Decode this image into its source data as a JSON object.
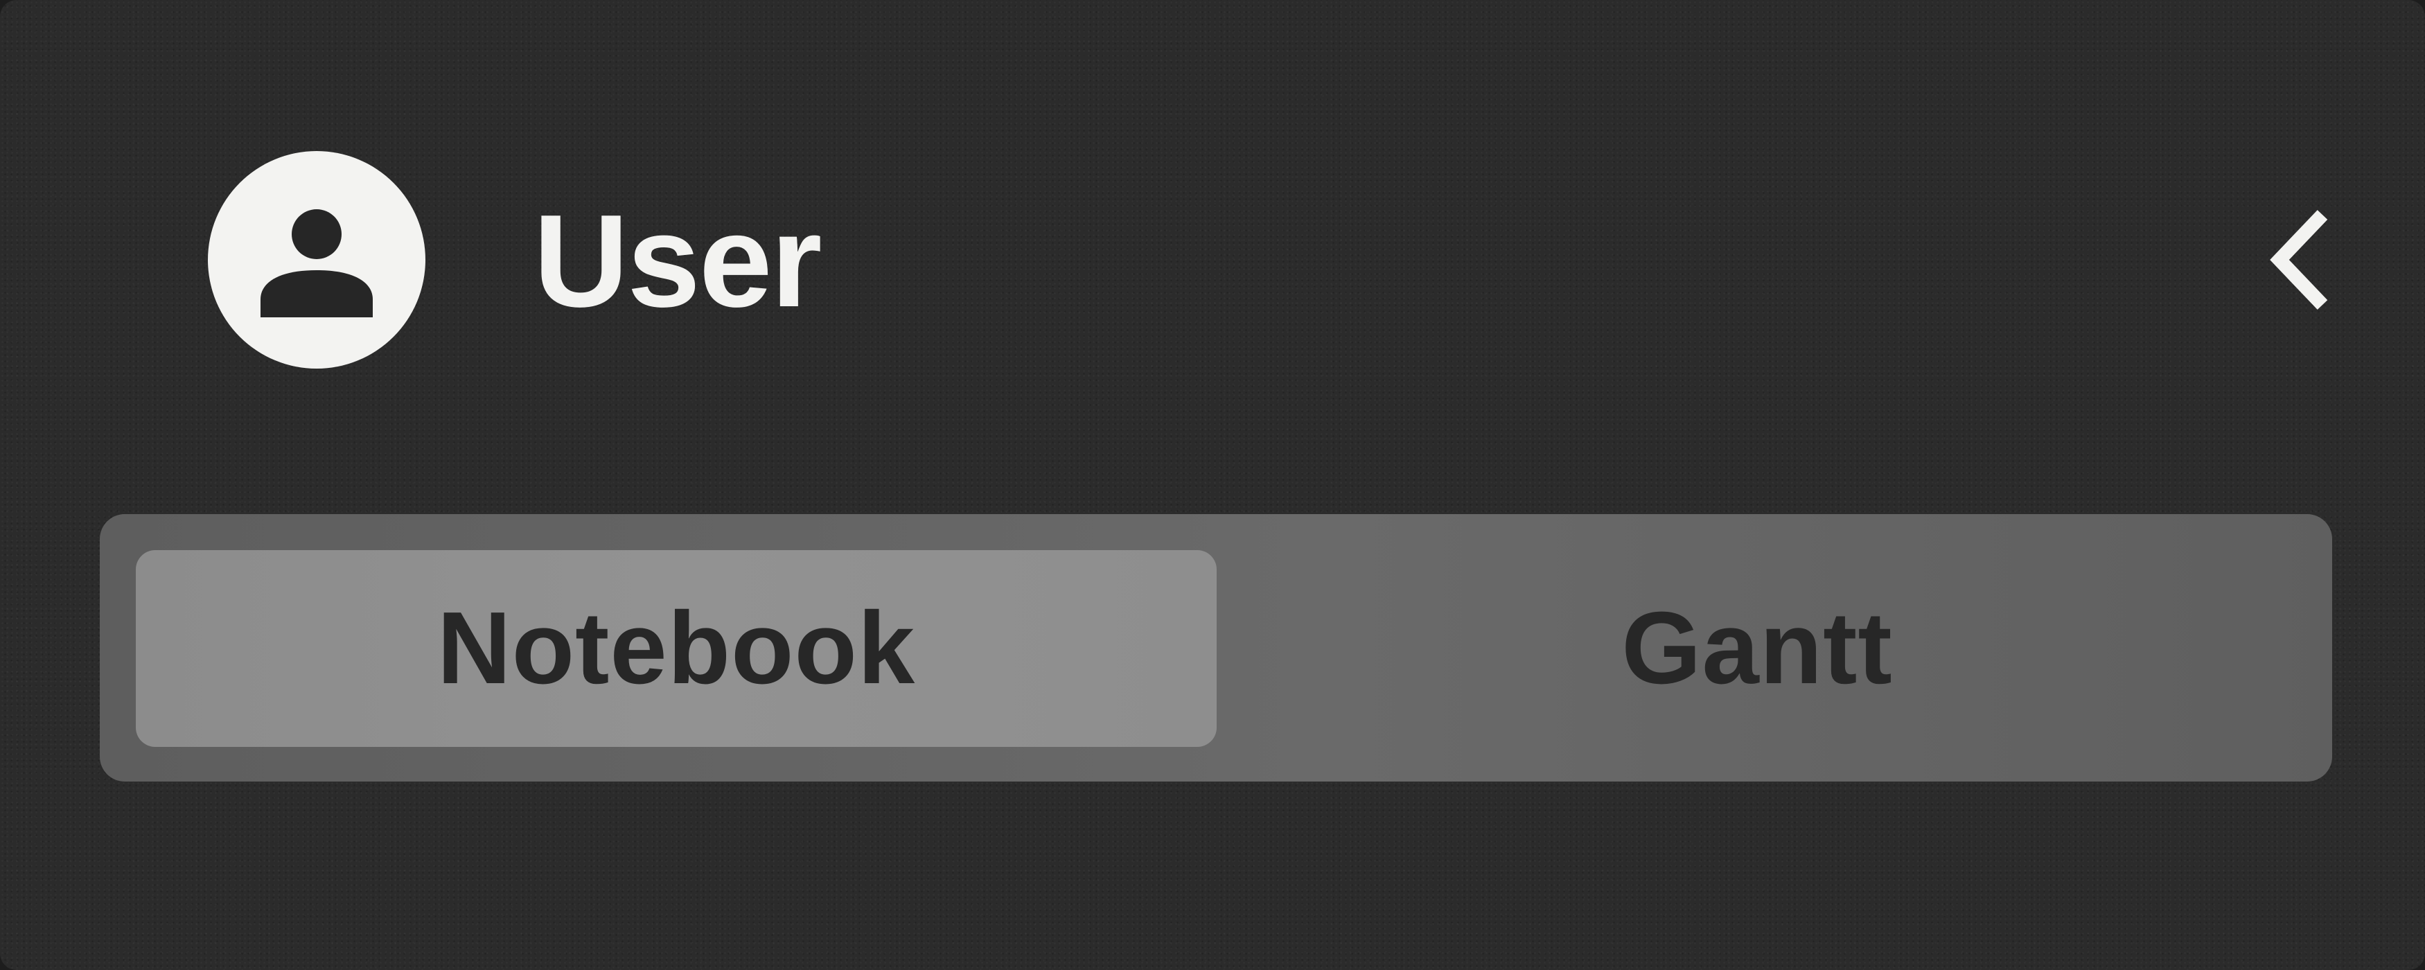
{
  "header": {
    "avatar_icon": "user-avatar-icon",
    "title": "User",
    "collapse_icon": "chevron-left-icon"
  },
  "view_switcher": {
    "options": [
      {
        "label": "Notebook",
        "selected": true
      },
      {
        "label": "Gantt",
        "selected": false
      }
    ]
  },
  "colors": {
    "panel_background": "#2b2b2b",
    "text_light": "#f3f3f1",
    "segmented_track": "#646464",
    "segment_selected": "#909090",
    "segment_text": "#272727"
  }
}
